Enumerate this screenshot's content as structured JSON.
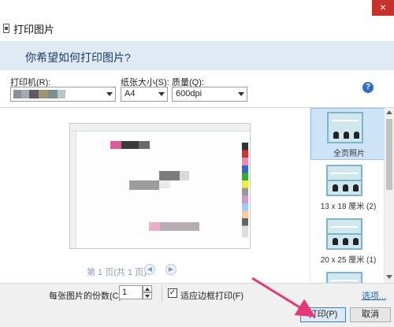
{
  "window": {
    "title": "打印图片",
    "close_label": "×"
  },
  "header": {
    "question": "你希望如何打印图片?"
  },
  "printer": {
    "label": "打印机(R):",
    "swatches": [
      {
        "color": "#8d8d95",
        "w": 10
      },
      {
        "color": "#a8a8b0",
        "w": 10
      },
      {
        "color": "#5d5a64",
        "w": 12
      },
      {
        "color": "#9e9474",
        "w": 12
      },
      {
        "color": "#7e8e95",
        "w": 12
      },
      {
        "color": "#b7c7c2",
        "w": 10
      }
    ]
  },
  "paper_size": {
    "label": "纸张大小(S):",
    "value": "A4"
  },
  "quality": {
    "label": "质量(Q):",
    "value": "600dpi"
  },
  "help": {
    "icon": "?"
  },
  "preview": {
    "page_info": "第 1 页(共 1 页)",
    "prev_icon": "◀",
    "next_icon": "▶",
    "blocks": [
      {
        "color": "#e25a95"
      },
      {
        "color": "#3c3c3c"
      },
      {
        "color": "#6a6a6a"
      },
      {
        "color": "#7c7c7c"
      },
      {
        "color": "#d9d9d9"
      },
      {
        "color": "#9d9d9d"
      },
      {
        "color": "#eaeaea"
      },
      {
        "color": "#e8b0c6"
      },
      {
        "color": "#b6adb3"
      }
    ]
  },
  "layouts": [
    {
      "label": "全页照片",
      "selected": true
    },
    {
      "label": "13 x 18 厘米 (2)",
      "selected": false
    },
    {
      "label": "20 x 25 厘米 (1)",
      "selected": false
    },
    {
      "label": "",
      "selected": false
    }
  ],
  "footer": {
    "copies_label": "每张图片的份数(C):",
    "copies_value": "1",
    "fit_label": "适应边框打印(F)",
    "fit_checked": "✓",
    "options_link": "选项...",
    "print_button": "打印(P)",
    "cancel_button": "取消"
  },
  "annotation": {
    "arrow_color": "#e8367a"
  }
}
